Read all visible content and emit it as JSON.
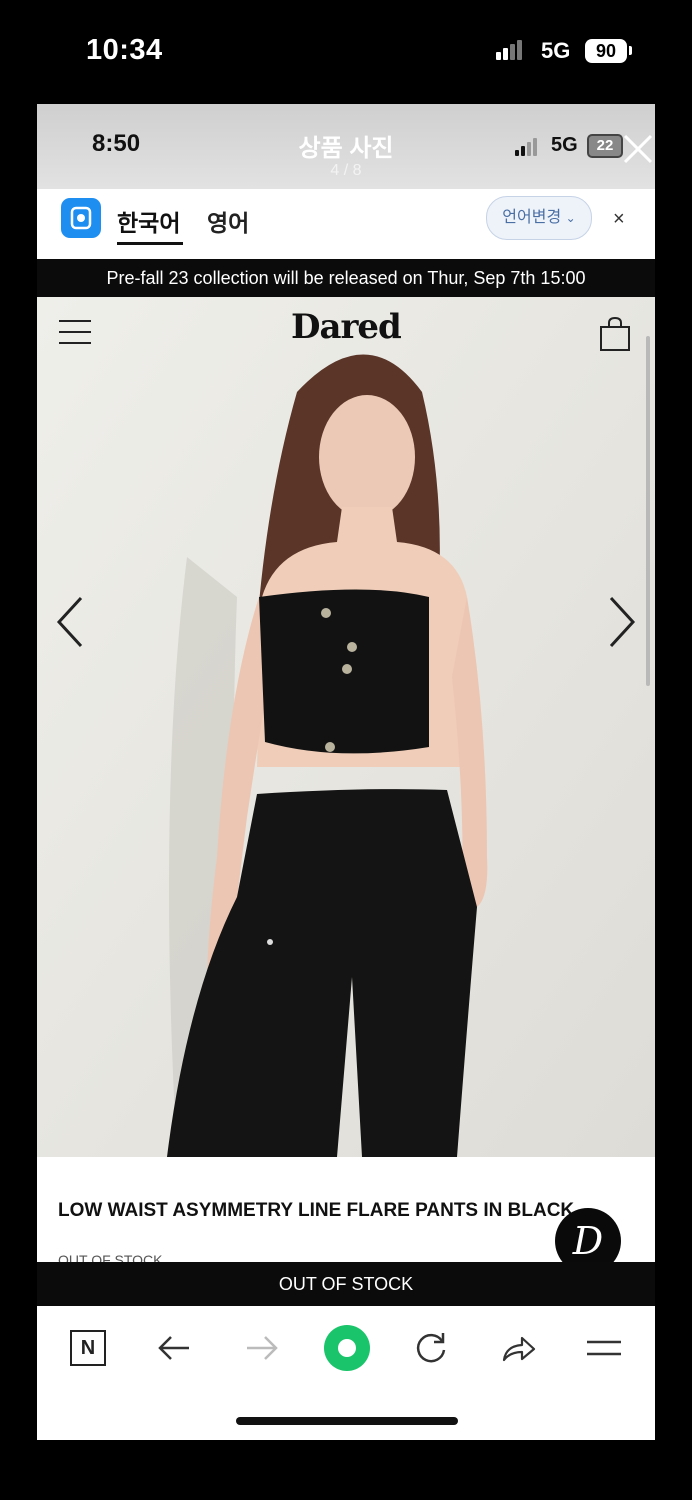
{
  "outer_status": {
    "time": "10:34",
    "network": "5G",
    "battery": "90"
  },
  "viewer": {
    "title": "상품 사진",
    "counter": "4 / 8",
    "inner_status": {
      "time": "8:50",
      "network": "5G",
      "battery": "22"
    }
  },
  "translator": {
    "tabs": [
      {
        "label": "한국어",
        "active": true
      },
      {
        "label": "영어",
        "active": false
      }
    ],
    "change_label": "언어변경",
    "close_symbol": "×"
  },
  "announcement": "Pre-fall 23 collection will be released on Thur, Sep 7th 15:00",
  "store": {
    "brand": "Dared"
  },
  "product": {
    "name": "LOW WAIST ASYMMETRY LINE FLARE PANTS IN BLACK",
    "stock_note": "OUT OF STOCK",
    "stock_button": "OUT OF STOCK",
    "badge_letter": "D",
    "image": "photo-model-black-tube-top-black-pants"
  },
  "colors": {
    "accent_green": "#19c46a",
    "translate_blue": "#1f8ef1",
    "bar_black": "#0b0b0b"
  },
  "toolbar": {
    "items": [
      "naver-n-icon",
      "back-arrow-icon",
      "forward-arrow-icon",
      "green-dot-icon",
      "reload-icon",
      "share-icon",
      "menu-icon"
    ],
    "home_label": "N"
  }
}
